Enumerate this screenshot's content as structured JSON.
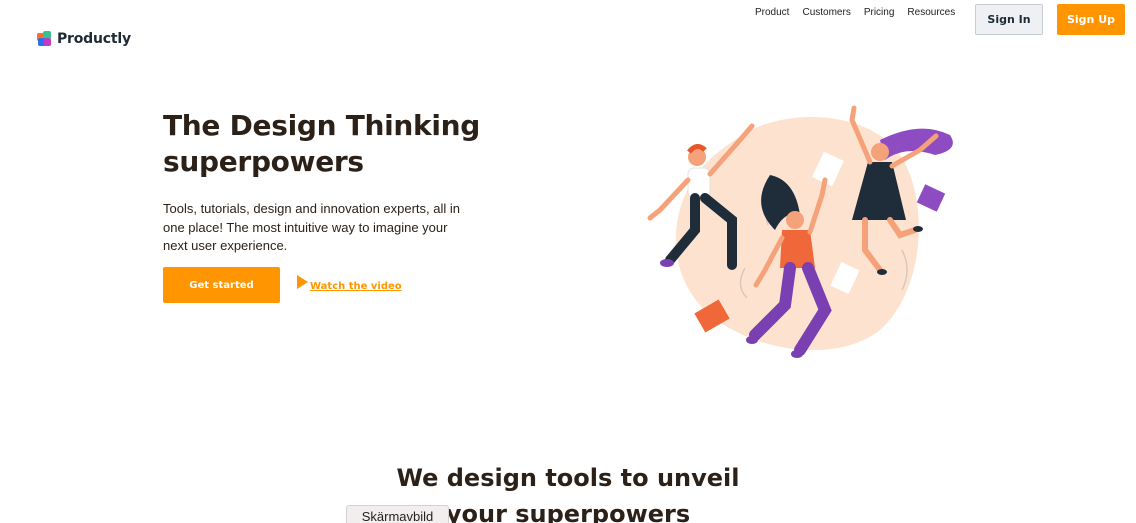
{
  "brand": {
    "name": "Productly",
    "logo_icon": "productly-logo-icon"
  },
  "nav": {
    "items": [
      "Product",
      "Customers",
      "Pricing",
      "Resources"
    ],
    "sign_in": "Sign In",
    "sign_up": "Sign Up"
  },
  "hero": {
    "title_line1": "The Design Thinking",
    "title_line2": "superpowers",
    "text": "Tools, tutorials, design and innovation experts, all in one place! The most intuitive way to imagine your next user experience.",
    "cta": "Get started",
    "video_link": "Watch the video",
    "play_icon": "play-icon",
    "illustration_icon": "people-jumping-illustration"
  },
  "section": {
    "title_line1": "We design tools to unveil",
    "title_line2": "your superpowers"
  },
  "tooltip": {
    "text": "Skärmavbild"
  },
  "colors": {
    "accent": "#ff9500",
    "heading": "#2b2118",
    "blob": "#fde3cf"
  }
}
